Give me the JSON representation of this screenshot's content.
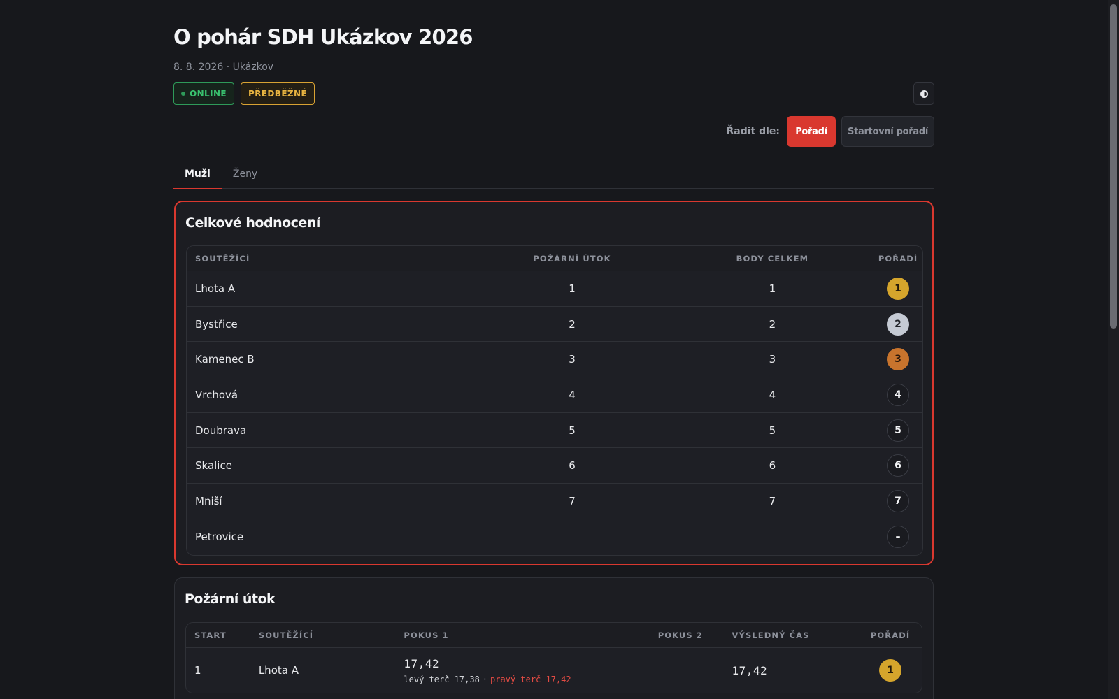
{
  "header": {
    "title": "O pohár SDH Ukázkov 2026",
    "subtitle": "8. 8. 2026 · Ukázkov",
    "badge_online": "ONLINE",
    "badge_prelim": "PŘEDBĚŽNÉ"
  },
  "sort": {
    "label": "Řadit dle:",
    "active": "Pořadí",
    "inactive": "Startovní pořadí"
  },
  "tabs": [
    "Muži",
    "Ženy"
  ],
  "overall": {
    "title": "Celkové hodnocení",
    "headers": [
      "SOUTĚŽÍCÍ",
      "POŽÁRNÍ ÚTOK",
      "BODY CELKEM",
      "POŘADÍ"
    ],
    "rows": [
      {
        "name": "Lhota A",
        "attack": "1",
        "points": "1",
        "rank": "1",
        "medal": "gold"
      },
      {
        "name": "Bystřice",
        "attack": "2",
        "points": "2",
        "rank": "2",
        "medal": "silver"
      },
      {
        "name": "Kamenec B",
        "attack": "3",
        "points": "3",
        "rank": "3",
        "medal": "bronze"
      },
      {
        "name": "Vrchová",
        "attack": "4",
        "points": "4",
        "rank": "4",
        "medal": ""
      },
      {
        "name": "Doubrava",
        "attack": "5",
        "points": "5",
        "rank": "5",
        "medal": ""
      },
      {
        "name": "Skalice",
        "attack": "6",
        "points": "6",
        "rank": "6",
        "medal": ""
      },
      {
        "name": "Mniší",
        "attack": "7",
        "points": "7",
        "rank": "7",
        "medal": ""
      },
      {
        "name": "Petrovice",
        "attack": "",
        "points": "",
        "rank": "–",
        "medal": ""
      }
    ]
  },
  "attack": {
    "title": "Požární útok",
    "headers": [
      "START",
      "SOUTĚŽÍCÍ",
      "POKUS 1",
      "POKUS 2",
      "VÝSLEDNÝ ČAS",
      "POŘADÍ"
    ],
    "rows": [
      {
        "start": "1",
        "name": "Lhota A",
        "p1_time": "17,42",
        "p1_left": "levý terč 17,38",
        "p1_sep": "·",
        "p1_right": "pravý terč 17,42",
        "p2": "",
        "result": "17,42",
        "rank": "1"
      }
    ]
  },
  "colors": {
    "accent": "#d9382f",
    "online": "#39c26f",
    "prelim": "#e8b441",
    "gold": "#d5a52c",
    "silver": "#c5cad4",
    "bronze": "#c8742d"
  }
}
